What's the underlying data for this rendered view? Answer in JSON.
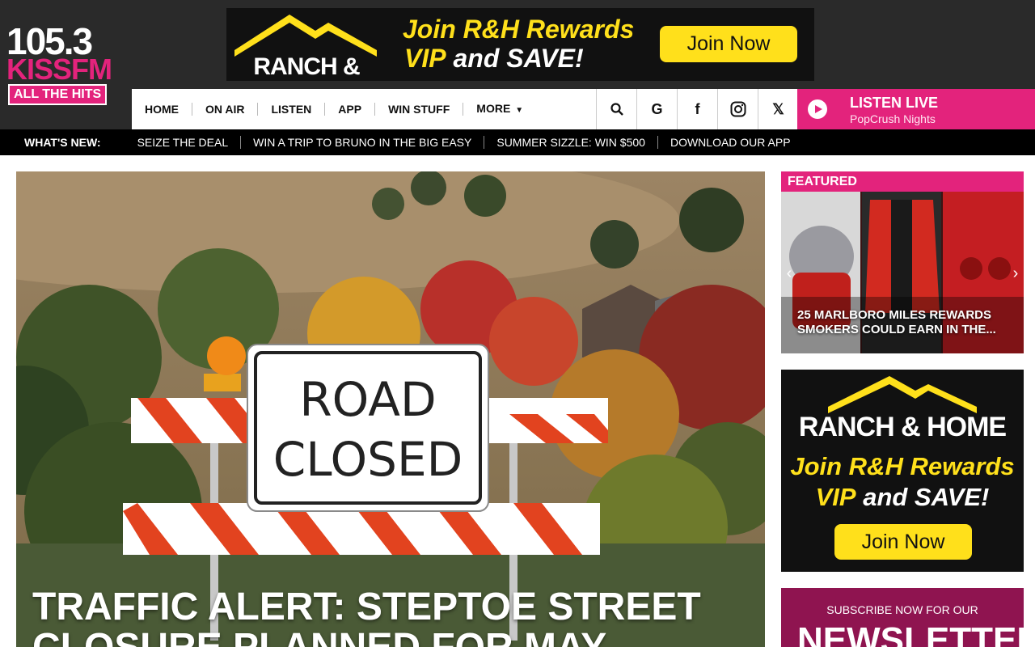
{
  "logo": {
    "number": "105.3",
    "brand": "KISSFM",
    "tagline": "ALL THE HITS"
  },
  "top_ad": {
    "brand": "RANCH & HOME",
    "line1": "Join R&H Rewards",
    "line2_a": "VIP",
    "line2_b": " and SAVE!",
    "cta": "Join Now"
  },
  "nav": {
    "items": [
      "HOME",
      "ON AIR",
      "LISTEN",
      "APP",
      "WIN STUFF",
      "MORE"
    ]
  },
  "social": {
    "icons": [
      "search-icon",
      "google-icon",
      "facebook-icon",
      "instagram-icon",
      "x-icon"
    ],
    "glyphs": {
      "google": "G",
      "facebook": "f",
      "x": "𝕏"
    }
  },
  "listen_live": {
    "label": "LISTEN LIVE",
    "show": "PopCrush Nights"
  },
  "whats_new": {
    "label": "WHAT'S NEW:",
    "links": [
      "SEIZE THE DEAL",
      "WIN A TRIP TO BRUNO IN THE BIG EASY",
      "SUMMER SIZZLE: WIN $500",
      "DOWNLOAD OUR APP"
    ]
  },
  "hero": {
    "sign_line1": "ROAD",
    "sign_line2": "CLOSED",
    "headline": "TRAFFIC ALERT: STEPTOE STREET CLOSURE PLANNED FOR MAY"
  },
  "featured": {
    "label": "FEATURED",
    "caption": "25 MARLBORO MILES REWARDS SMOKERS COULD EARN IN THE...",
    "prev": "‹",
    "next": "›"
  },
  "side_ad": {
    "brand": "RANCH & HOME",
    "line1": "Join R&H Rewards",
    "line2_a": "VIP",
    "line2_b": " and SAVE!",
    "cta": "Join Now"
  },
  "newsletter": {
    "sub": "SUBSCRIBE NOW FOR OUR",
    "big": "NEWSLETTER"
  },
  "colors": {
    "brand_pink": "#e3237c",
    "header_bg": "#2a2a2a",
    "ad_yellow": "#ffe01b"
  }
}
